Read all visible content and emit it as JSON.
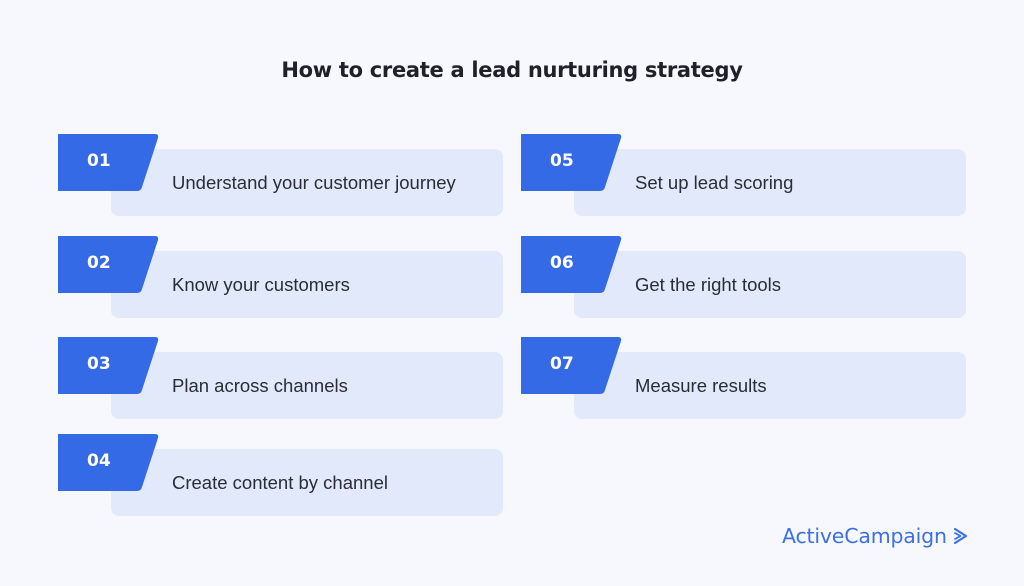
{
  "title": "How to create a lead nurturing strategy",
  "colors": {
    "background": "#F6F8FE",
    "badge": "#356AE6",
    "card": "#E2E9FB",
    "text": "#2a2d35",
    "brand": "#3d6fe3"
  },
  "steps": [
    {
      "number": "01",
      "label": "Understand your customer journey"
    },
    {
      "number": "02",
      "label": "Know your customers"
    },
    {
      "number": "03",
      "label": "Plan across channels"
    },
    {
      "number": "04",
      "label": "Create content by channel"
    },
    {
      "number": "05",
      "label": "Set up lead scoring"
    },
    {
      "number": "06",
      "label": "Get the right tools"
    },
    {
      "number": "07",
      "label": "Measure results"
    }
  ],
  "logo": {
    "text": "ActiveCampaign",
    "icon": "chevron-right-icon"
  }
}
